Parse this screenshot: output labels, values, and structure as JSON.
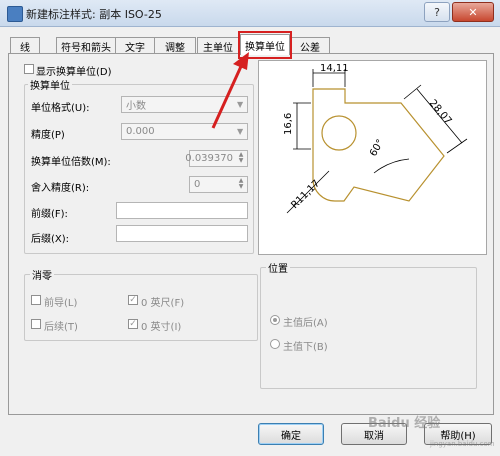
{
  "window": {
    "title": "新建标注样式: 副本 ISO-25",
    "help_label": "?",
    "close_label": "✕"
  },
  "tabs": [
    {
      "label": "线"
    },
    {
      "label": "符号和箭头"
    },
    {
      "label": "文字"
    },
    {
      "label": "调整"
    },
    {
      "label": "主单位"
    },
    {
      "label": "换算单位"
    },
    {
      "label": "公差"
    }
  ],
  "alt_units": {
    "display_label": "显示换算单位(D)",
    "display_checked": false,
    "group_title": "换算单位",
    "unit_format_label": "单位格式(U):",
    "unit_format_value": "小数",
    "precision_label": "精度(P)",
    "precision_value": "0.000",
    "multiplier_label": "换算单位倍数(M):",
    "multiplier_value": "0.039370",
    "roundoff_label": "舍入精度(R):",
    "roundoff_value": "0",
    "prefix_label": "前缀(F):",
    "prefix_value": "",
    "suffix_label": "后缀(X):",
    "suffix_value": ""
  },
  "zero_suppression": {
    "title": "消零",
    "leading_label": "前导(L)",
    "leading_checked": false,
    "trailing_label": "后续(T)",
    "trailing_checked": false,
    "feet_label": "0 英尺(F)",
    "feet_checked": true,
    "inches_label": "0 英寸(I)",
    "inches_checked": true
  },
  "placement": {
    "title": "位置",
    "after_label": "主值后(A)",
    "after_selected": true,
    "below_label": "主值下(B)",
    "below_selected": false
  },
  "preview": {
    "dim_top": "14,11",
    "dim_left": "16,6",
    "dim_right": "28,07",
    "dim_angle": "60°",
    "dim_radius": "R11,17"
  },
  "buttons": {
    "ok": "确定",
    "cancel": "取消",
    "help": "帮助(H)"
  },
  "watermark": {
    "text": "Baidu 经验",
    "sub": "jingyan.baidu.com"
  },
  "colors": {
    "highlight_red": "#d62020",
    "preview_shape": "#b8912f"
  }
}
